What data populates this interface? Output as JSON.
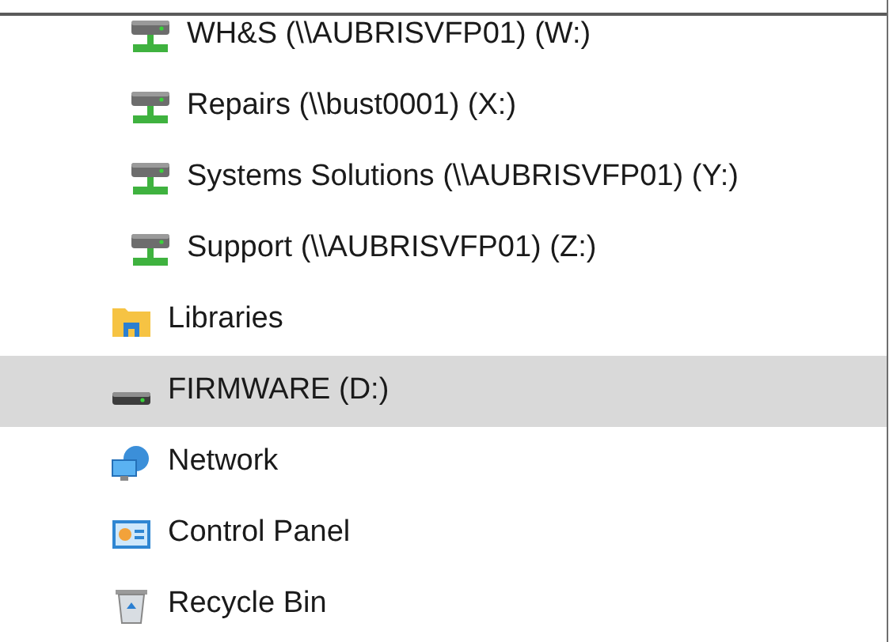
{
  "navigation_tree": {
    "items": [
      {
        "children": [
          {
            "label": "WH&S (\\\\AUBRISVFP01) (W:)",
            "kind": "network-drive",
            "selected": false
          },
          {
            "label": "Repairs (\\\\bust0001) (X:)",
            "kind": "network-drive",
            "selected": false
          },
          {
            "label": "Systems Solutions (\\\\AUBRISVFP01) (Y:)",
            "kind": "network-drive",
            "selected": false
          },
          {
            "label": "Support (\\\\AUBRISVFP01) (Z:)",
            "kind": "network-drive",
            "selected": false
          }
        ]
      },
      {
        "label": "Libraries",
        "kind": "library",
        "selected": false
      },
      {
        "label": "FIRMWARE (D:)",
        "kind": "drive",
        "selected": true
      },
      {
        "label": "Network",
        "kind": "network",
        "selected": false
      },
      {
        "label": "Control Panel",
        "kind": "control-panel",
        "selected": false
      },
      {
        "label": "Recycle Bin",
        "kind": "recycle-bin",
        "selected": false
      }
    ]
  }
}
